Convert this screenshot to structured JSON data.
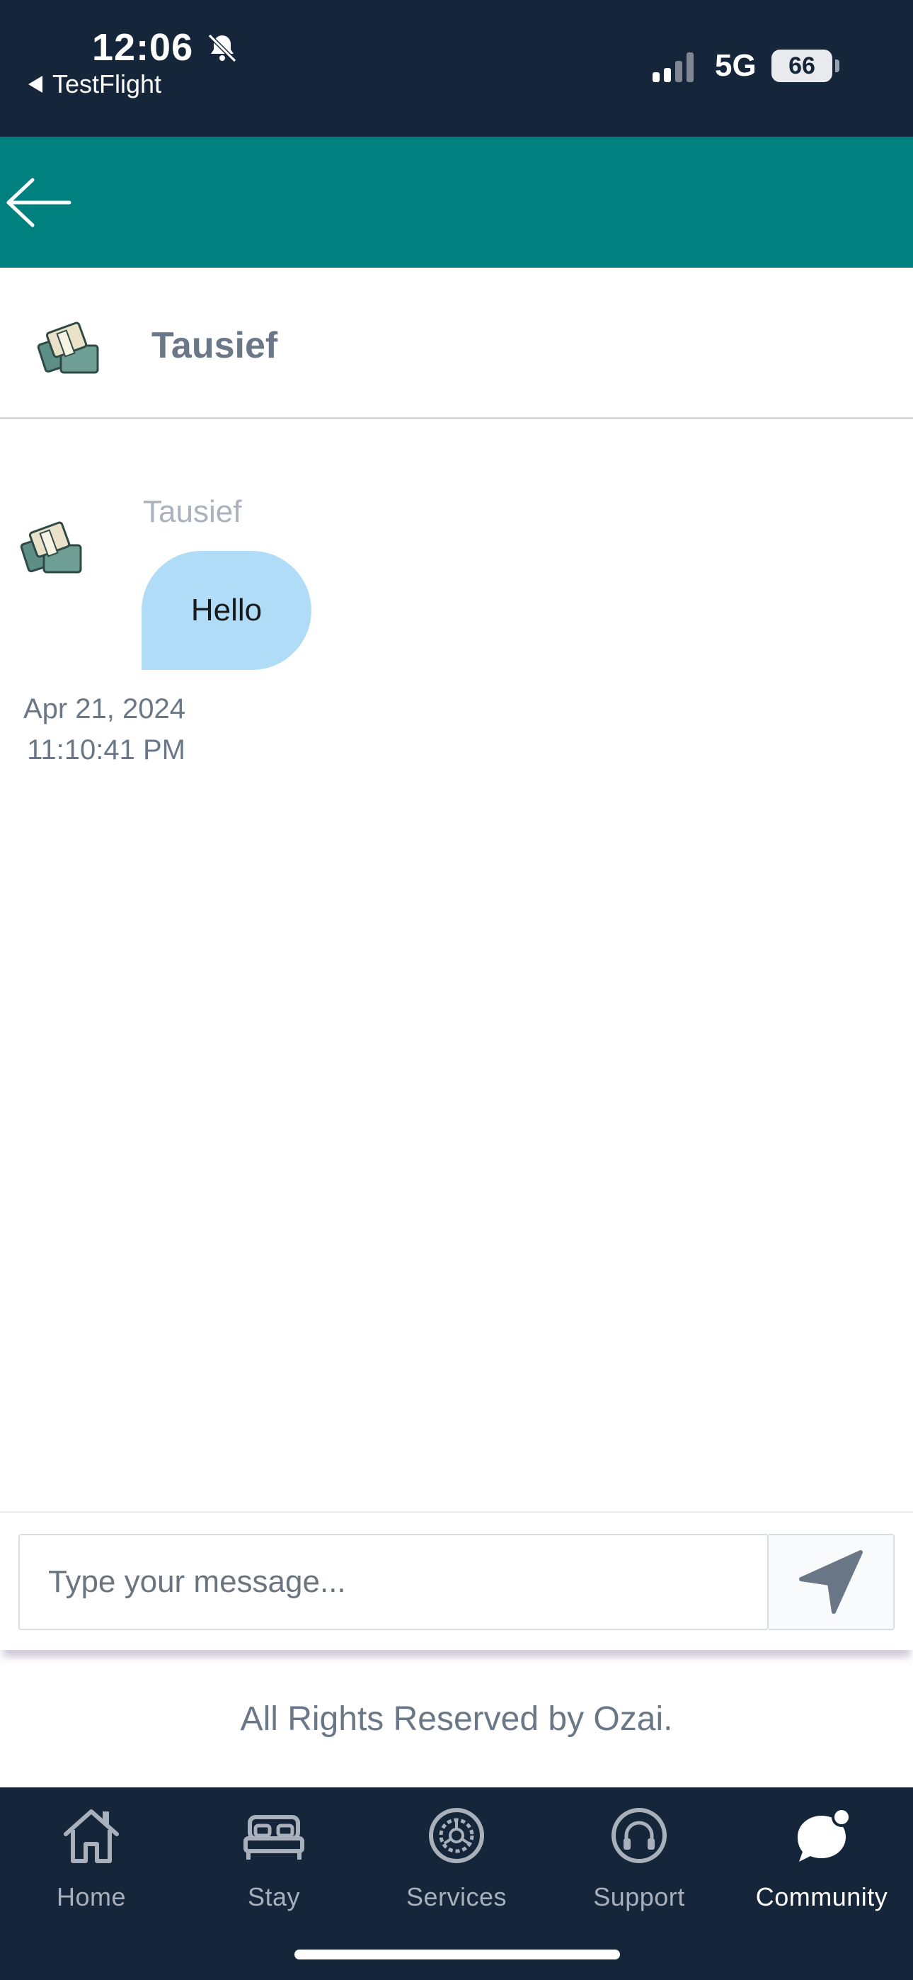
{
  "status_bar": {
    "time": "12:06",
    "back_app": "TestFlight",
    "network": "5G",
    "battery": "66"
  },
  "chat": {
    "title": "Tausief"
  },
  "message": {
    "sender": "Tausief",
    "text": "Hello",
    "date": "Apr 21, 2024",
    "time": "11:10:41 PM"
  },
  "composer": {
    "placeholder": "Type your message..."
  },
  "footer": {
    "text": "All Rights Reserved by Ozai."
  },
  "nav": {
    "items": [
      {
        "label": "Home",
        "icon": "home-icon"
      },
      {
        "label": "Stay",
        "icon": "bed-icon"
      },
      {
        "label": "Services",
        "icon": "gear-icon"
      },
      {
        "label": "Support",
        "icon": "headphones-icon"
      },
      {
        "label": "Community",
        "icon": "chat-bubbles-icon"
      }
    ],
    "active": "Community"
  },
  "colors": {
    "header": "#00807f",
    "status_bar": "#15253a",
    "bubble": "#b1dcf7",
    "nav_bg": "#15253a"
  }
}
